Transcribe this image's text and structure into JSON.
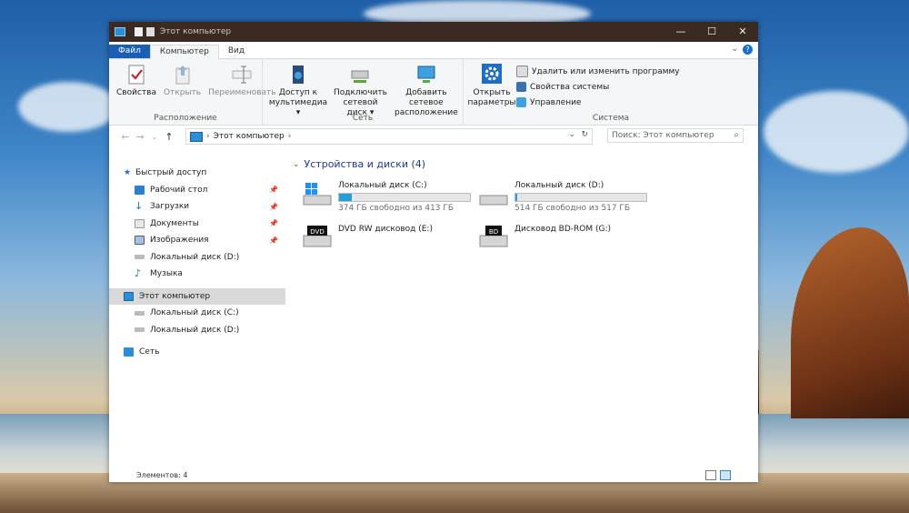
{
  "window": {
    "title": "Этот компьютер",
    "controls": {
      "minimize": "—",
      "maximize": "☐",
      "close": "✕"
    }
  },
  "tabs": [
    {
      "label": "Файл"
    },
    {
      "label": "Компьютер"
    },
    {
      "label": "Вид"
    }
  ],
  "ribbon": {
    "groups": {
      "location": {
        "label": "Расположение",
        "buttons": [
          {
            "label": "Свойства"
          },
          {
            "label": "Открыть"
          },
          {
            "label": "Переименовать"
          }
        ]
      },
      "network": {
        "label": "Сеть",
        "buttons": [
          {
            "label": "Доступ к мультимедиа ▾"
          },
          {
            "label": "Подключить сетевой диск ▾"
          },
          {
            "label": "Добавить сетевое расположение"
          }
        ]
      },
      "system": {
        "label": "Система",
        "open_settings": "Открыть параметры",
        "items": [
          {
            "label": "Удалить или изменить программу"
          },
          {
            "label": "Свойства системы"
          },
          {
            "label": "Управление"
          }
        ]
      }
    }
  },
  "address": {
    "path_label": "Этот компьютер",
    "search_placeholder": "Поиск: Этот компьютер"
  },
  "nav": {
    "quick_access": "Быстрый доступ",
    "quick_items": [
      {
        "label": "Рабочий стол"
      },
      {
        "label": "Загрузки"
      },
      {
        "label": "Документы"
      },
      {
        "label": "Изображения"
      },
      {
        "label": "Локальный диск (D:)"
      },
      {
        "label": "Музыка"
      }
    ],
    "this_pc": "Этот компьютер",
    "pc_items": [
      {
        "label": "Локальный диск (C:)"
      },
      {
        "label": "Локальный диск (D:)"
      }
    ],
    "network": "Сеть"
  },
  "content": {
    "group_title": "Устройства и диски (4)",
    "drives": [
      {
        "name": "Локальный диск (C:)",
        "free": "374 ГБ свободно из 413 ГБ",
        "used_fraction": 0.094
      },
      {
        "name": "Локальный диск (D:)",
        "free": "514 ГБ свободно из 517 ГБ",
        "used_fraction": 0.006
      },
      {
        "name": "DVD RW дисковод (E:)",
        "badge": "DVD"
      },
      {
        "name": "Дисковод BD-ROM (G:)",
        "badge": "BD"
      }
    ]
  },
  "status": {
    "items_count": "Элементов: 4"
  },
  "colors": {
    "accent": "#1a5fb4",
    "progress": "#26a0da",
    "titlebar": "#3a2a22"
  }
}
